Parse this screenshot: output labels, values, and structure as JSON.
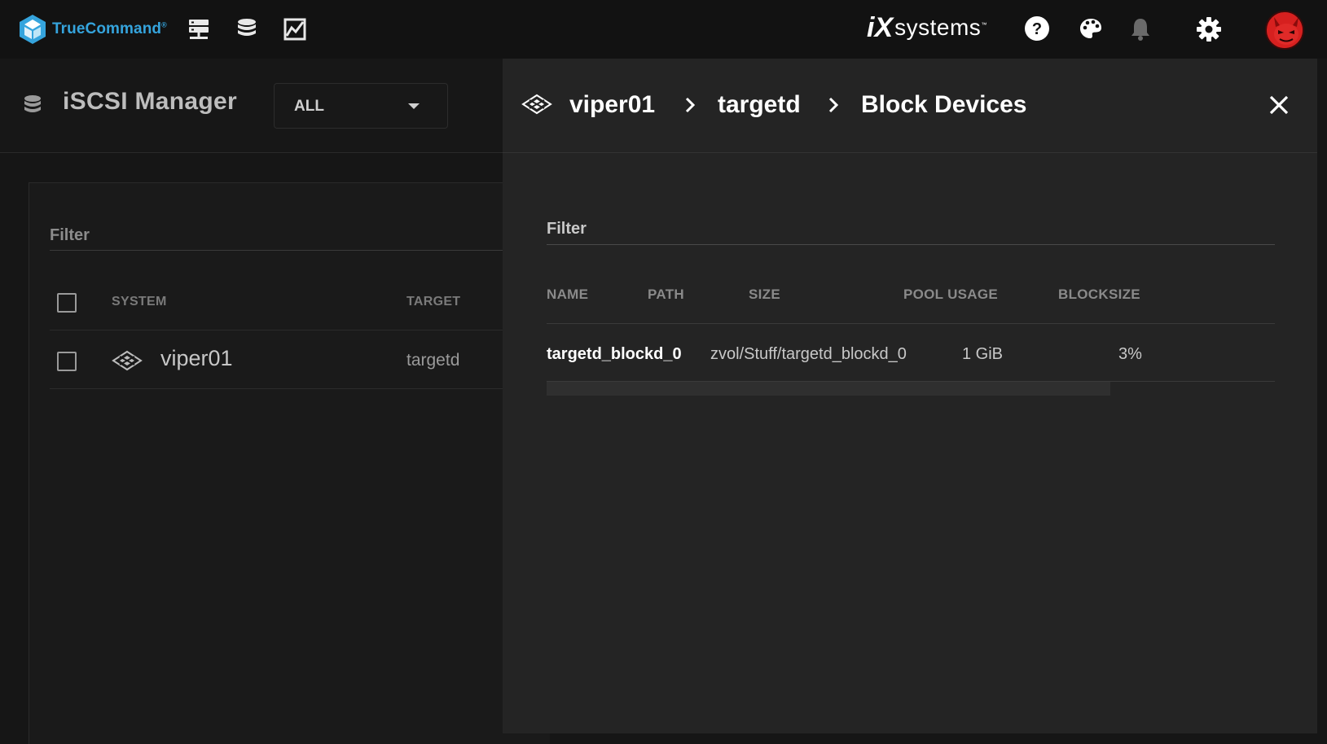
{
  "topbar": {
    "brand": "TrueCommand",
    "brand_mark": "®",
    "nav_icons": [
      "systems-icon",
      "storage-icon",
      "reports-icon"
    ],
    "ix_logo": {
      "mark": "iX",
      "text": "systems",
      "tm": "™"
    },
    "right_icons": [
      "help-icon",
      "palette-icon",
      "bell-icon",
      "gear-icon",
      "avatar"
    ]
  },
  "page": {
    "title": "iSCSI Manager",
    "select_value": "ALL",
    "filter_label": "Filter",
    "columns": [
      "SYSTEM",
      "TARGET"
    ],
    "rows": [
      {
        "system": "viper01",
        "target": "targetd"
      }
    ]
  },
  "panel": {
    "breadcrumb": [
      "viper01",
      "targetd",
      "Block Devices"
    ],
    "filter_label": "Filter",
    "columns": [
      "NAME",
      "PATH",
      "SIZE",
      "POOL USAGE",
      "BLOCKSIZE"
    ],
    "rows": [
      {
        "name": "targetd_blockd_0",
        "path": "zvol/Stuff/targetd_blockd_0",
        "size": "1 GiB",
        "pool_usage": "3%"
      }
    ]
  },
  "colors": {
    "brand": "#35a4dd",
    "background": "#161616",
    "panel": "#242424",
    "avatar": "#d6201f"
  }
}
